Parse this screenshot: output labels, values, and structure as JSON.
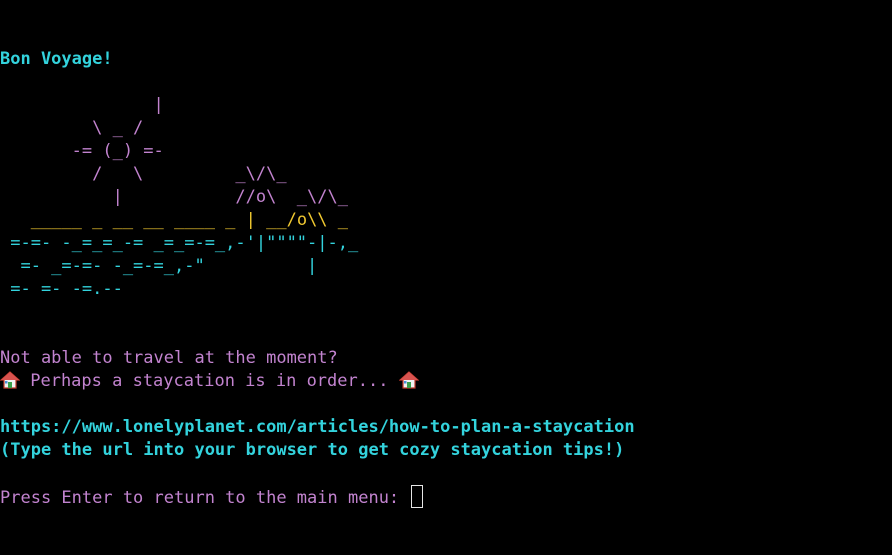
{
  "colors": {
    "background": "#000000",
    "cyan": "#33d3dd",
    "pink": "#c283cf",
    "orange": "#f0c830"
  },
  "title": "Bon Voyage!",
  "ascii_art": {
    "sun_line1": "               |",
    "sun_line2": "         \\ _ /",
    "sun_line3": "       -= (_) =-",
    "sun_line4": "         /   \\         _\\/\\_",
    "sun_line5": "           |           //o\\  _\\/\\_",
    "ship_line1": "   _____ _ __ __ ____ _ ",
    "ship_line1_mast": "|",
    "ship_line1_rest": " __/o\\\\ _",
    "wave_line1": " =-=- -_=_=_-= _=_=-=_,-'|\"\"\"\"-|-,_",
    "wave_line2": "  =- _=-=- -_=-=_,-\"          |",
    "wave_line3": " =- =- -=.--"
  },
  "message": {
    "line1": "Not able to travel at the moment?",
    "line2": " Perhaps a staycation is in order... ",
    "url": "https://www.lonelyplanet.com/articles/how-to-plan-a-staycation",
    "hint": "(Type the url into your browser to get cozy staycation tips!)"
  },
  "prompt": {
    "text": "Press Enter to return to the main menu: "
  },
  "icons": {
    "house": "house-icon"
  }
}
